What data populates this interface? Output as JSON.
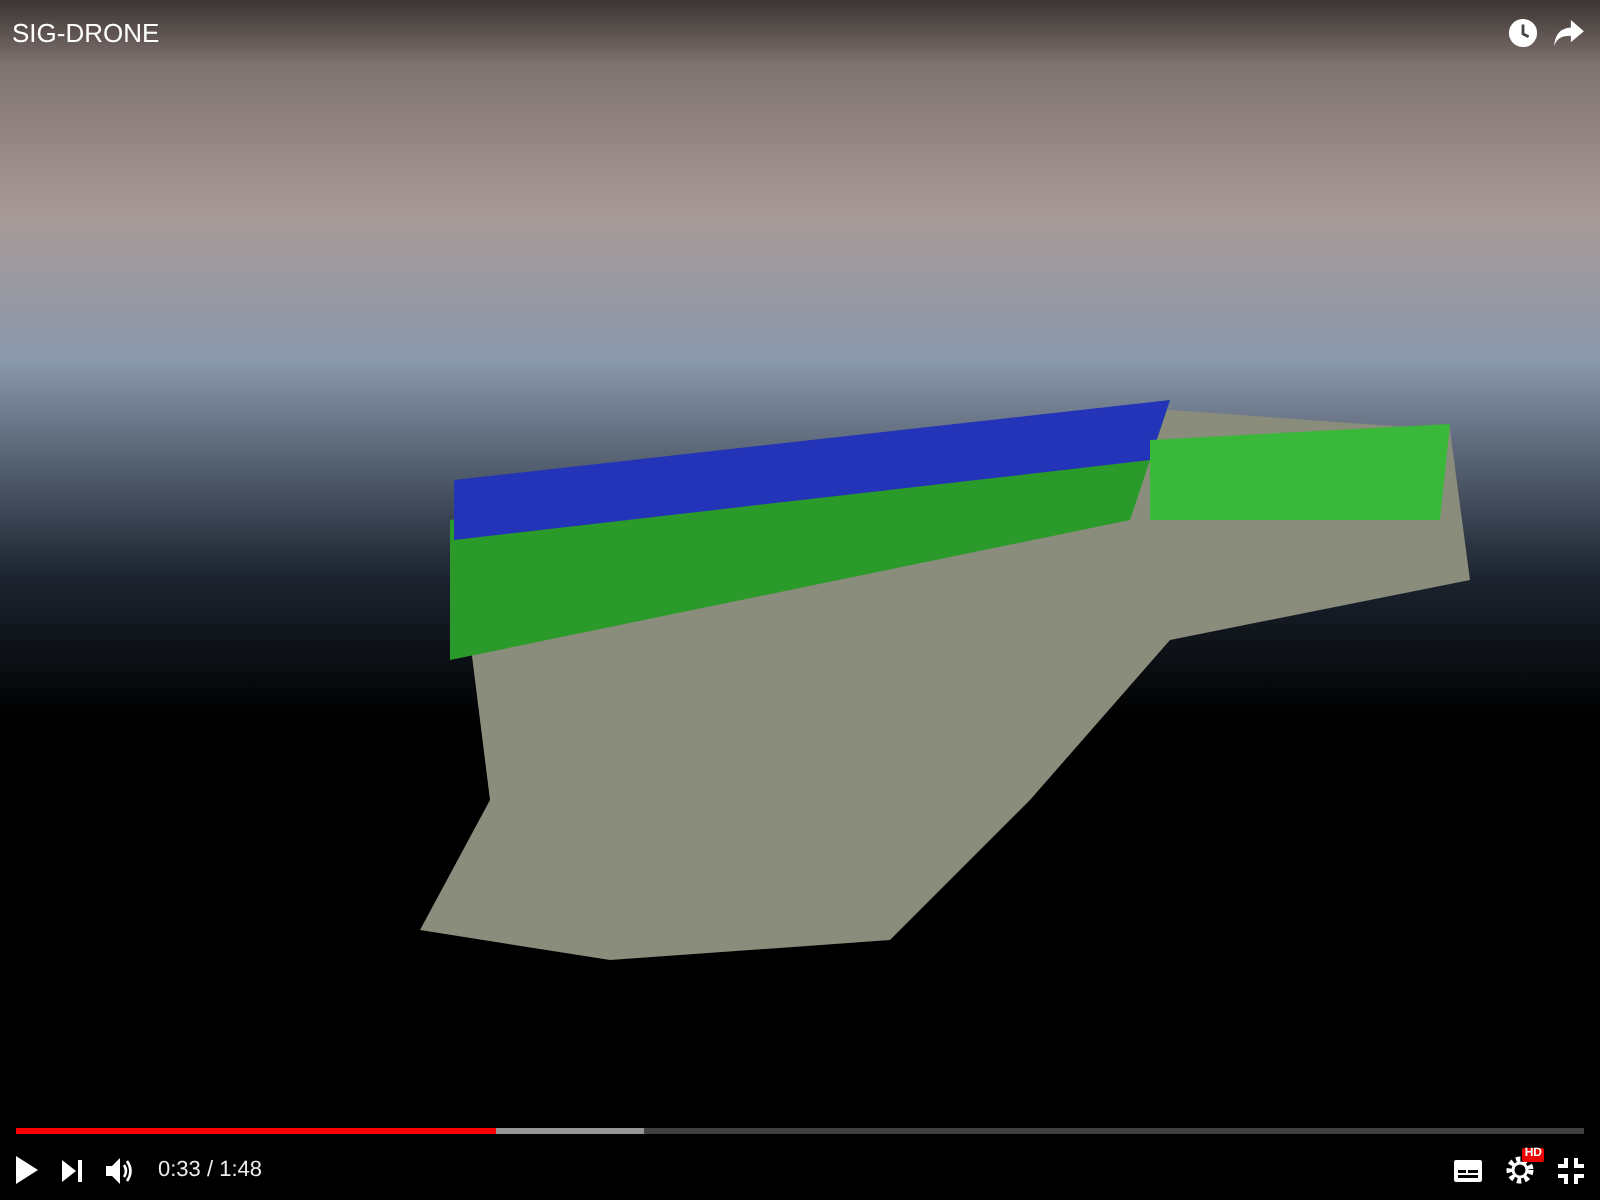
{
  "video": {
    "title": "SIG-DRONE"
  },
  "controls": {
    "time": "0:33 / 1:48",
    "progress": {
      "level": 0.306
    },
    "buffered": {
      "level": 0.4
    },
    "quality_badge": "HD"
  }
}
